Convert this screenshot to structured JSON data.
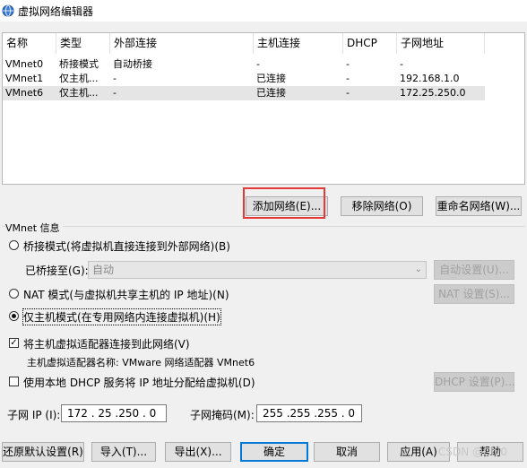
{
  "window": {
    "title": "虚拟网络编辑器"
  },
  "table": {
    "columns": [
      "名称",
      "类型",
      "外部连接",
      "主机连接",
      "DHCP",
      "子网地址"
    ],
    "rows": [
      [
        "VMnet0",
        "桥接模式",
        "自动桥接",
        "-",
        "-",
        "-"
      ],
      [
        "VMnet1",
        "仅主机...",
        "-",
        "已连接",
        "-",
        "192.168.1.0"
      ],
      [
        "VMnet6",
        "仅主机...",
        "-",
        "已连接",
        "-",
        "172.25.250.0"
      ]
    ],
    "selected_row": 2
  },
  "list_buttons": {
    "add": "添加网络(E)...",
    "remove": "移除网络(O)",
    "rename": "重命名网络(W)..."
  },
  "info": {
    "group_label": "VMnet 信息",
    "bridged": {
      "label": "桥接模式(将虚拟机直接连接到外部网络)(B)",
      "selected": false
    },
    "bridged_to_label": "已桥接至(G):",
    "bridged_to_value": "自动",
    "auto_settings": "自动设置(U)...",
    "nat": {
      "label": "NAT 模式(与虚拟机共享主机的 IP 地址)(N)",
      "selected": false
    },
    "nat_settings": "NAT 设置(S)...",
    "hostonly": {
      "label": "仅主机模式(在专用网络内连接虚拟机)(H)",
      "selected": true
    },
    "connect_adapter": {
      "label": "将主机虚拟适配器连接到此网络(V)",
      "checked": true
    },
    "adapter_name": "主机虚拟适配器名称: VMware 网络适配器 VMnet6",
    "use_dhcp": {
      "label": "使用本地 DHCP 服务将 IP 地址分配给虚拟机(D)",
      "checked": false
    },
    "dhcp_settings": "DHCP 设置(P)...",
    "subnet_ip_label": "子网 IP (I):",
    "subnet_ip": "172 . 25 .250 . 0",
    "subnet_mask_label": "子网掩码(M):",
    "subnet_mask": "255 .255 .255 . 0"
  },
  "footer_buttons": {
    "restore": "还原默认设置(R)",
    "import": "导入(T)...",
    "export": "导出(X)...",
    "ok": "确定",
    "cancel": "取消",
    "apply": "应用(A)",
    "help": "帮助"
  },
  "watermark": "CSDN @Chi0"
}
